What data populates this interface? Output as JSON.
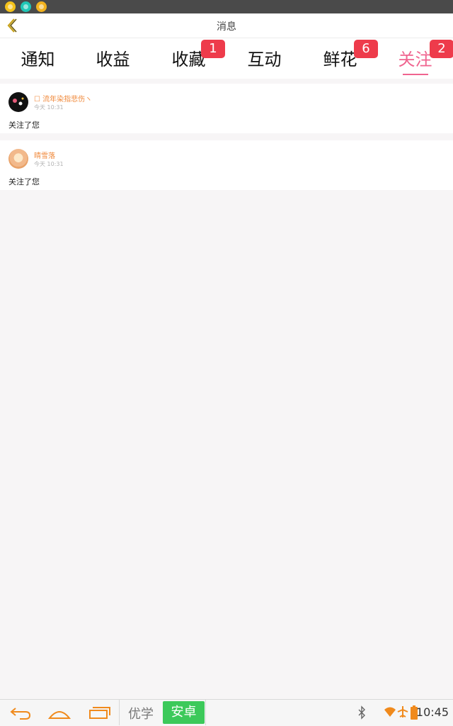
{
  "header": {
    "title": "消息"
  },
  "tabs": [
    {
      "label": "通知",
      "badge": ""
    },
    {
      "label": "收益",
      "badge": ""
    },
    {
      "label": "收藏",
      "badge": "1"
    },
    {
      "label": "互动",
      "badge": ""
    },
    {
      "label": "鲜花",
      "badge": "6"
    },
    {
      "label": "关注",
      "badge": "2",
      "active": true
    }
  ],
  "messages": [
    {
      "user": "☐ 流年染指悲伤ヽ",
      "time": "今天 10:31",
      "text": "关注了您"
    },
    {
      "user": "晴雪落",
      "time": "今天 10:31",
      "text": "关注了您"
    }
  ],
  "navbar": {
    "brand_left": "优学",
    "brand_right": "安卓",
    "clock": "10:45"
  },
  "colors": {
    "accent": "#f0648f",
    "badge": "#ee3b4b",
    "username": "#f08a3c",
    "brand_green": "#3cc95a"
  },
  "icons": [
    "back-icon",
    "nav-back-icon",
    "nav-home-icon",
    "nav-recent-icon",
    "bluetooth-icon",
    "wifi-icon",
    "airplane-icon",
    "battery-icon"
  ]
}
